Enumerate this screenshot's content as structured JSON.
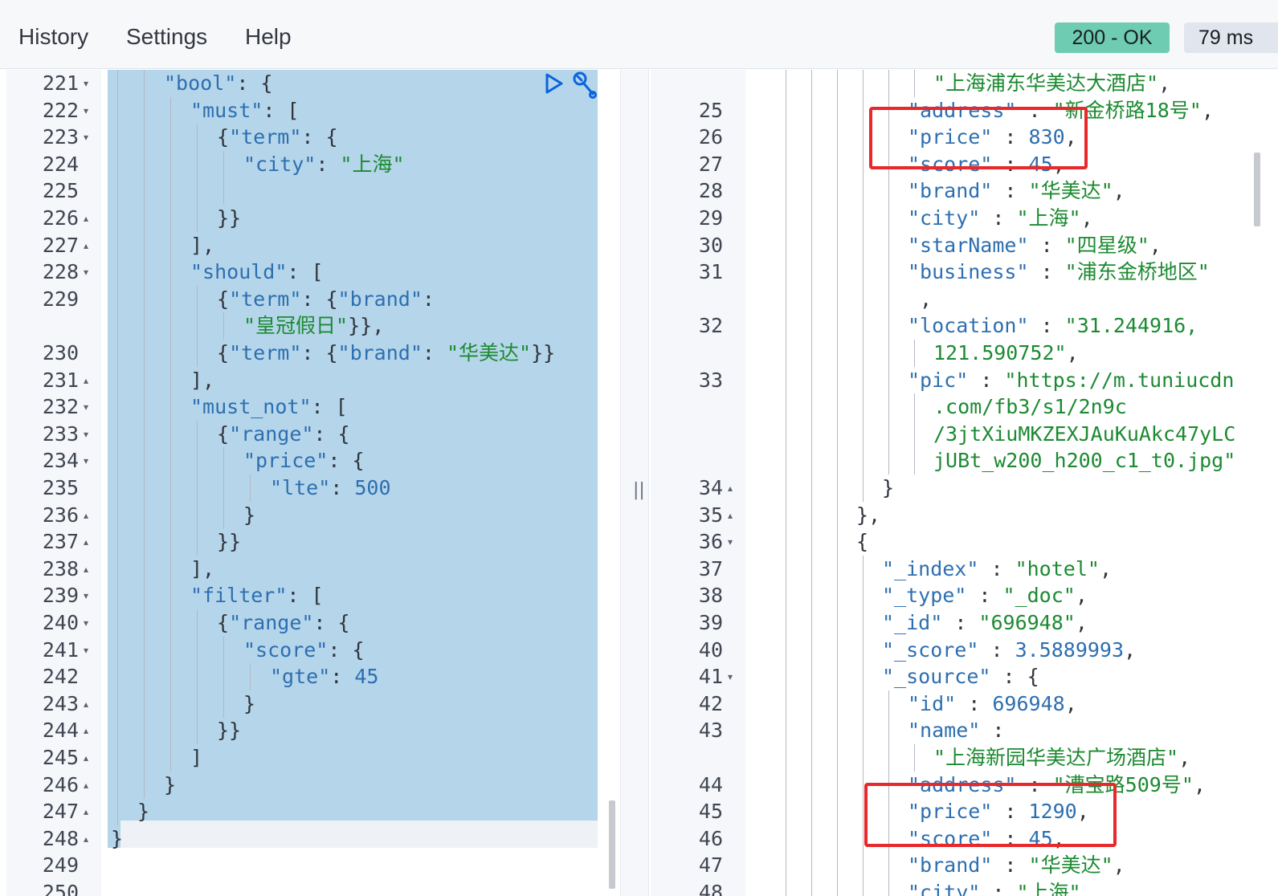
{
  "nav": {
    "history": "History",
    "settings": "Settings",
    "help": "Help"
  },
  "status": {
    "code": "200 - OK",
    "time": "79 ms",
    "ok_color": "#6dccb1"
  },
  "request_lines": [
    {
      "n": "221",
      "fold": "▾",
      "indent": 2,
      "t": [
        [
          "k",
          "\"bool\""
        ],
        [
          "p",
          ": {"
        ]
      ]
    },
    {
      "n": "222",
      "fold": "▾",
      "indent": 3,
      "t": [
        [
          "k",
          "\"must\""
        ],
        [
          "p",
          ": ["
        ]
      ]
    },
    {
      "n": "223",
      "fold": "▾",
      "indent": 4,
      "t": [
        [
          "p",
          "{"
        ],
        [
          "k",
          "\"term\""
        ],
        [
          "p",
          ": {"
        ]
      ]
    },
    {
      "n": "224",
      "fold": "",
      "indent": 5,
      "t": [
        [
          "k",
          "\"city\""
        ],
        [
          "p",
          ": "
        ],
        [
          "s",
          "\"上海\""
        ]
      ]
    },
    {
      "n": "225",
      "fold": "",
      "indent": 5,
      "t": []
    },
    {
      "n": "226",
      "fold": "▴",
      "indent": 4,
      "t": [
        [
          "p",
          "}}"
        ]
      ]
    },
    {
      "n": "227",
      "fold": "▴",
      "indent": 3,
      "t": [
        [
          "p",
          "],"
        ]
      ]
    },
    {
      "n": "228",
      "fold": "▾",
      "indent": 3,
      "t": [
        [
          "k",
          "\"should\""
        ],
        [
          "p",
          ": ["
        ]
      ]
    },
    {
      "n": "229",
      "fold": "",
      "indent": 4,
      "t": [
        [
          "p",
          "{"
        ],
        [
          "k",
          "\"term\""
        ],
        [
          "p",
          ": {"
        ],
        [
          "k",
          "\"brand\""
        ],
        [
          "p",
          ":"
        ]
      ]
    },
    {
      "n": "",
      "fold": "",
      "indent": 5,
      "t": [
        [
          "s",
          "\"皇冠假日\""
        ],
        [
          "p",
          "}},"
        ]
      ]
    },
    {
      "n": "230",
      "fold": "",
      "indent": 4,
      "t": [
        [
          "p",
          "{"
        ],
        [
          "k",
          "\"term\""
        ],
        [
          "p",
          ": {"
        ],
        [
          "k",
          "\"brand\""
        ],
        [
          "p",
          ": "
        ],
        [
          "s",
          "\"华美达\""
        ],
        [
          "p",
          "}}"
        ]
      ]
    },
    {
      "n": "231",
      "fold": "▴",
      "indent": 3,
      "t": [
        [
          "p",
          "],"
        ]
      ]
    },
    {
      "n": "232",
      "fold": "▾",
      "indent": 3,
      "t": [
        [
          "k",
          "\"must_not\""
        ],
        [
          "p",
          ": ["
        ]
      ]
    },
    {
      "n": "233",
      "fold": "▾",
      "indent": 4,
      "t": [
        [
          "p",
          "{"
        ],
        [
          "k",
          "\"range\""
        ],
        [
          "p",
          ": {"
        ]
      ]
    },
    {
      "n": "234",
      "fold": "▾",
      "indent": 5,
      "t": [
        [
          "k",
          "\"price\""
        ],
        [
          "p",
          ": {"
        ]
      ]
    },
    {
      "n": "235",
      "fold": "",
      "indent": 6,
      "t": [
        [
          "k",
          "\"lte\""
        ],
        [
          "p",
          ": "
        ],
        [
          "n",
          "500"
        ]
      ]
    },
    {
      "n": "236",
      "fold": "▴",
      "indent": 5,
      "t": [
        [
          "p",
          "}"
        ]
      ]
    },
    {
      "n": "237",
      "fold": "▴",
      "indent": 4,
      "t": [
        [
          "p",
          "}}"
        ]
      ]
    },
    {
      "n": "238",
      "fold": "▴",
      "indent": 3,
      "t": [
        [
          "p",
          "],"
        ]
      ]
    },
    {
      "n": "239",
      "fold": "▾",
      "indent": 3,
      "t": [
        [
          "k",
          "\"filter\""
        ],
        [
          "p",
          ": ["
        ]
      ]
    },
    {
      "n": "240",
      "fold": "▾",
      "indent": 4,
      "t": [
        [
          "p",
          "{"
        ],
        [
          "k",
          "\"range\""
        ],
        [
          "p",
          ": {"
        ]
      ]
    },
    {
      "n": "241",
      "fold": "▾",
      "indent": 5,
      "t": [
        [
          "k",
          "\"score\""
        ],
        [
          "p",
          ": {"
        ]
      ]
    },
    {
      "n": "242",
      "fold": "",
      "indent": 6,
      "t": [
        [
          "k",
          "\"gte\""
        ],
        [
          "p",
          ": "
        ],
        [
          "n",
          "45"
        ]
      ]
    },
    {
      "n": "243",
      "fold": "▴",
      "indent": 5,
      "t": [
        [
          "p",
          "}"
        ]
      ]
    },
    {
      "n": "244",
      "fold": "▴",
      "indent": 4,
      "t": [
        [
          "p",
          "}}"
        ]
      ]
    },
    {
      "n": "245",
      "fold": "▴",
      "indent": 3,
      "t": [
        [
          "p",
          "]"
        ]
      ]
    },
    {
      "n": "246",
      "fold": "▴",
      "indent": 2,
      "t": [
        [
          "p",
          "}"
        ]
      ]
    },
    {
      "n": "247",
      "fold": "▴",
      "indent": 1,
      "t": [
        [
          "p",
          "}"
        ]
      ]
    },
    {
      "n": "248",
      "fold": "▴",
      "indent": 0,
      "t": [
        [
          "p",
          "}"
        ]
      ]
    },
    {
      "n": "249",
      "fold": "",
      "indent": 0,
      "t": []
    },
    {
      "n": "250",
      "fold": "",
      "indent": 0,
      "t": []
    }
  ],
  "response_lines": [
    {
      "n": "",
      "fold": "",
      "indent": 6,
      "t": [
        [
          "s",
          "\"上海浦东华美达大酒店\""
        ],
        [
          "p",
          ","
        ]
      ]
    },
    {
      "n": "25",
      "fold": "",
      "indent": 5,
      "t": [
        [
          "k",
          "\"address\""
        ],
        [
          "p",
          " : "
        ],
        [
          "s",
          "\"新金桥路18号\""
        ],
        [
          "p",
          ","
        ]
      ]
    },
    {
      "n": "26",
      "fold": "",
      "indent": 5,
      "t": [
        [
          "k",
          "\"price\""
        ],
        [
          "p",
          " : "
        ],
        [
          "n",
          "830"
        ],
        [
          "p",
          ","
        ]
      ]
    },
    {
      "n": "27",
      "fold": "",
      "indent": 5,
      "t": [
        [
          "k",
          "\"score\""
        ],
        [
          "p",
          " : "
        ],
        [
          "n",
          "45"
        ],
        [
          "p",
          ","
        ]
      ]
    },
    {
      "n": "28",
      "fold": "",
      "indent": 5,
      "t": [
        [
          "k",
          "\"brand\""
        ],
        [
          "p",
          " : "
        ],
        [
          "s",
          "\"华美达\""
        ],
        [
          "p",
          ","
        ]
      ]
    },
    {
      "n": "29",
      "fold": "",
      "indent": 5,
      "t": [
        [
          "k",
          "\"city\""
        ],
        [
          "p",
          " : "
        ],
        [
          "s",
          "\"上海\""
        ],
        [
          "p",
          ","
        ]
      ]
    },
    {
      "n": "30",
      "fold": "",
      "indent": 5,
      "t": [
        [
          "k",
          "\"starName\""
        ],
        [
          "p",
          " : "
        ],
        [
          "s",
          "\"四星级\""
        ],
        [
          "p",
          ","
        ]
      ]
    },
    {
      "n": "31",
      "fold": "",
      "indent": 5,
      "t": [
        [
          "k",
          "\"business\""
        ],
        [
          "p",
          " : "
        ],
        [
          "s",
          "\"浦东金桥地区\""
        ]
      ]
    },
    {
      "n": "",
      "fold": "",
      "indent": 5,
      "t": [
        [
          "p",
          " ,"
        ]
      ]
    },
    {
      "n": "32",
      "fold": "",
      "indent": 5,
      "t": [
        [
          "k",
          "\"location\""
        ],
        [
          "p",
          " : "
        ],
        [
          "s",
          "\"31.244916,"
        ]
      ]
    },
    {
      "n": "",
      "fold": "",
      "indent": 6,
      "t": [
        [
          "s",
          "121.590752\""
        ],
        [
          "p",
          ","
        ]
      ]
    },
    {
      "n": "33",
      "fold": "",
      "indent": 5,
      "t": [
        [
          "k",
          "\"pic\""
        ],
        [
          "p",
          " : "
        ],
        [
          "s",
          "\"https://m.tuniucdn"
        ]
      ]
    },
    {
      "n": "",
      "fold": "",
      "indent": 6,
      "t": [
        [
          "s",
          ".com/fb3/s1/2n9c"
        ]
      ]
    },
    {
      "n": "",
      "fold": "",
      "indent": 6,
      "t": [
        [
          "s",
          "/3jtXiuMKZEXJAuKuAkc47yLC"
        ]
      ]
    },
    {
      "n": "",
      "fold": "",
      "indent": 6,
      "t": [
        [
          "s",
          "jUBt_w200_h200_c1_t0.jpg\""
        ]
      ]
    },
    {
      "n": "34",
      "fold": "▴",
      "indent": 4,
      "t": [
        [
          "p",
          "}"
        ]
      ]
    },
    {
      "n": "35",
      "fold": "▴",
      "indent": 3,
      "t": [
        [
          "p",
          "},"
        ]
      ]
    },
    {
      "n": "36",
      "fold": "▾",
      "indent": 3,
      "t": [
        [
          "p",
          "{"
        ]
      ]
    },
    {
      "n": "37",
      "fold": "",
      "indent": 4,
      "t": [
        [
          "k",
          "\"_index\""
        ],
        [
          "p",
          " : "
        ],
        [
          "s",
          "\"hotel\""
        ],
        [
          "p",
          ","
        ]
      ]
    },
    {
      "n": "38",
      "fold": "",
      "indent": 4,
      "t": [
        [
          "k",
          "\"_type\""
        ],
        [
          "p",
          " : "
        ],
        [
          "s",
          "\"_doc\""
        ],
        [
          "p",
          ","
        ]
      ]
    },
    {
      "n": "39",
      "fold": "",
      "indent": 4,
      "t": [
        [
          "k",
          "\"_id\""
        ],
        [
          "p",
          " : "
        ],
        [
          "s",
          "\"696948\""
        ],
        [
          "p",
          ","
        ]
      ]
    },
    {
      "n": "40",
      "fold": "",
      "indent": 4,
      "t": [
        [
          "k",
          "\"_score\""
        ],
        [
          "p",
          " : "
        ],
        [
          "n",
          "3.5889993"
        ],
        [
          "p",
          ","
        ]
      ]
    },
    {
      "n": "41",
      "fold": "▾",
      "indent": 4,
      "t": [
        [
          "k",
          "\"_source\""
        ],
        [
          "p",
          " : {"
        ]
      ]
    },
    {
      "n": "42",
      "fold": "",
      "indent": 5,
      "t": [
        [
          "k",
          "\"id\""
        ],
        [
          "p",
          " : "
        ],
        [
          "n",
          "696948"
        ],
        [
          "p",
          ","
        ]
      ]
    },
    {
      "n": "43",
      "fold": "",
      "indent": 5,
      "t": [
        [
          "k",
          "\"name\""
        ],
        [
          "p",
          " :"
        ]
      ]
    },
    {
      "n": "",
      "fold": "",
      "indent": 6,
      "t": [
        [
          "s",
          "\"上海新园华美达广场酒店\""
        ],
        [
          "p",
          ","
        ]
      ]
    },
    {
      "n": "44",
      "fold": "",
      "indent": 5,
      "t": [
        [
          "k",
          "\"address\""
        ],
        [
          "p",
          " : "
        ],
        [
          "s",
          "\"漕宝路509号\""
        ],
        [
          "p",
          ","
        ]
      ]
    },
    {
      "n": "45",
      "fold": "",
      "indent": 5,
      "t": [
        [
          "k",
          "\"price\""
        ],
        [
          "p",
          " : "
        ],
        [
          "n",
          "1290"
        ],
        [
          "p",
          ","
        ]
      ]
    },
    {
      "n": "46",
      "fold": "",
      "indent": 5,
      "t": [
        [
          "k",
          "\"score\""
        ],
        [
          "p",
          " : "
        ],
        [
          "n",
          "45"
        ],
        [
          "p",
          ","
        ]
      ]
    },
    {
      "n": "47",
      "fold": "",
      "indent": 5,
      "t": [
        [
          "k",
          "\"brand\""
        ],
        [
          "p",
          " : "
        ],
        [
          "s",
          "\"华美达\""
        ],
        [
          "p",
          ","
        ]
      ]
    },
    {
      "n": "48",
      "fold": "",
      "indent": 5,
      "t": [
        [
          "k",
          "\"city\""
        ],
        [
          "p",
          " : "
        ],
        [
          "s",
          "\"上海\""
        ],
        [
          "p",
          ","
        ]
      ]
    }
  ],
  "icons": {
    "run": "play-icon",
    "wrench": "wrench-icon",
    "resizer": "||"
  }
}
